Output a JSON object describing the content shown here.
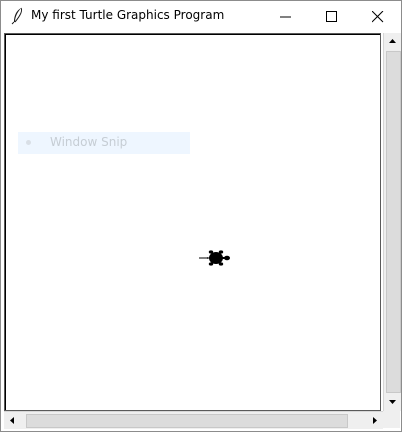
{
  "window": {
    "title": "My first Turtle Graphics Program",
    "icons": {
      "app": "feather-icon",
      "minimize": "minimize-icon",
      "maximize": "maximize-icon",
      "close": "close-icon"
    }
  },
  "canvas": {
    "overlay_label": "Window Snip",
    "turtle_icon": "turtle-icon",
    "turtle_color": "#000000"
  },
  "scrollbars": {
    "up_arrow": "▲",
    "down_arrow": "▼",
    "left_arrow": "◀",
    "right_arrow": "▶"
  }
}
